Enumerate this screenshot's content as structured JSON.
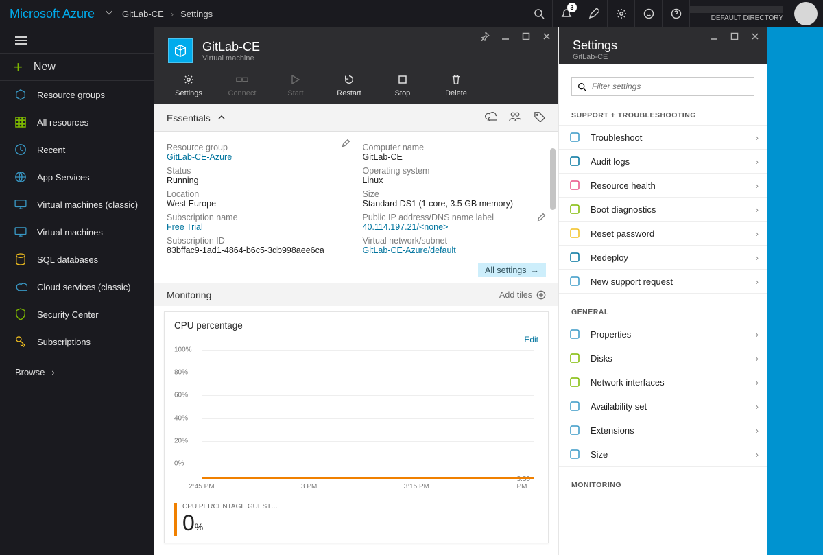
{
  "brand": "Microsoft Azure",
  "breadcrumb": [
    "GitLab-CE",
    "Settings"
  ],
  "notification_count": "3",
  "user": {
    "tenant": "DEFAULT DIRECTORY"
  },
  "leftnav": {
    "new_label": "New",
    "items": [
      {
        "label": "Resource groups",
        "icon": "resource-groups-icon",
        "color": "#3999c6"
      },
      {
        "label": "All resources",
        "icon": "grid-icon",
        "color": "#7fba00"
      },
      {
        "label": "Recent",
        "icon": "clock-icon",
        "color": "#3999c6"
      },
      {
        "label": "App Services",
        "icon": "globe-icon",
        "color": "#3999c6"
      },
      {
        "label": "Virtual machines (classic)",
        "icon": "vm-icon",
        "color": "#3999c6"
      },
      {
        "label": "Virtual machines",
        "icon": "vm-icon",
        "color": "#3999c6"
      },
      {
        "label": "SQL databases",
        "icon": "sql-icon",
        "color": "#f2bf1e"
      },
      {
        "label": "Cloud services (classic)",
        "icon": "cloud-icon",
        "color": "#3999c6"
      },
      {
        "label": "Security Center",
        "icon": "shield-icon",
        "color": "#7fba00"
      },
      {
        "label": "Subscriptions",
        "icon": "key-icon",
        "color": "#f2bf1e"
      }
    ],
    "browse_label": "Browse"
  },
  "vm": {
    "title": "GitLab-CE",
    "subtitle": "Virtual machine",
    "toolbar": [
      {
        "label": "Settings",
        "icon": "gear-icon",
        "enabled": true
      },
      {
        "label": "Connect",
        "icon": "connect-icon",
        "enabled": false
      },
      {
        "label": "Start",
        "icon": "play-icon",
        "enabled": false
      },
      {
        "label": "Restart",
        "icon": "restart-icon",
        "enabled": true
      },
      {
        "label": "Stop",
        "icon": "stop-icon",
        "enabled": true
      },
      {
        "label": "Delete",
        "icon": "trash-icon",
        "enabled": true
      }
    ],
    "essentials_label": "Essentials",
    "essentials": {
      "left": [
        {
          "label": "Resource group",
          "value": "GitLab-CE-Azure",
          "link": true,
          "editable": true
        },
        {
          "label": "Status",
          "value": "Running"
        },
        {
          "label": "Location",
          "value": "West Europe"
        },
        {
          "label": "Subscription name",
          "value": "Free Trial",
          "link": true
        },
        {
          "label": "Subscription ID",
          "value": "83bffac9-1ad1-4864-b6c5-3db998aee6ca"
        }
      ],
      "right": [
        {
          "label": "Computer name",
          "value": "GitLab-CE"
        },
        {
          "label": "Operating system",
          "value": "Linux"
        },
        {
          "label": "Size",
          "value": "Standard DS1 (1 core, 3.5 GB memory)"
        },
        {
          "label": "Public IP address/DNS name label",
          "value": "40.114.197.21/<none>",
          "link": true,
          "editable": true
        },
        {
          "label": "Virtual network/subnet",
          "value": "GitLab-CE-Azure/default",
          "link": true
        }
      ]
    },
    "all_settings_label": "All settings",
    "monitoring_label": "Monitoring",
    "add_tiles_label": "Add tiles",
    "chart_title": "CPU percentage",
    "chart_edit_label": "Edit"
  },
  "chart_data": {
    "type": "line",
    "title": "CPU percentage",
    "ylabel": "",
    "xlabel": "",
    "ylim": [
      0,
      100
    ],
    "y_ticks": [
      "0%",
      "20%",
      "40%",
      "60%",
      "80%",
      "100%"
    ],
    "x_ticks": [
      "2:45 PM",
      "3 PM",
      "3:15 PM",
      "3:30 PM"
    ],
    "series": [
      {
        "name": "CPU PERCENTAGE GUEST…",
        "current_value": 0,
        "unit": "%",
        "color": "#f08000"
      }
    ]
  },
  "settings": {
    "title": "Settings",
    "subtitle": "GitLab-CE",
    "filter_placeholder": "Filter settings",
    "groups": [
      {
        "heading": "SUPPORT + TROUBLESHOOTING",
        "items": [
          {
            "label": "Troubleshoot",
            "color": "#3999c6"
          },
          {
            "label": "Audit logs",
            "color": "#00749e"
          },
          {
            "label": "Resource health",
            "color": "#e94f85"
          },
          {
            "label": "Boot diagnostics",
            "color": "#7fba00"
          },
          {
            "label": "Reset password",
            "color": "#f2bf1e"
          },
          {
            "label": "Redeploy",
            "color": "#00749e"
          },
          {
            "label": "New support request",
            "color": "#3999c6"
          }
        ]
      },
      {
        "heading": "GENERAL",
        "items": [
          {
            "label": "Properties",
            "color": "#3999c6"
          },
          {
            "label": "Disks",
            "color": "#7fba00"
          },
          {
            "label": "Network interfaces",
            "color": "#7fba00"
          },
          {
            "label": "Availability set",
            "color": "#3999c6"
          },
          {
            "label": "Extensions",
            "color": "#3999c6"
          },
          {
            "label": "Size",
            "color": "#3999c6"
          }
        ]
      },
      {
        "heading": "MONITORING",
        "items": []
      }
    ]
  }
}
